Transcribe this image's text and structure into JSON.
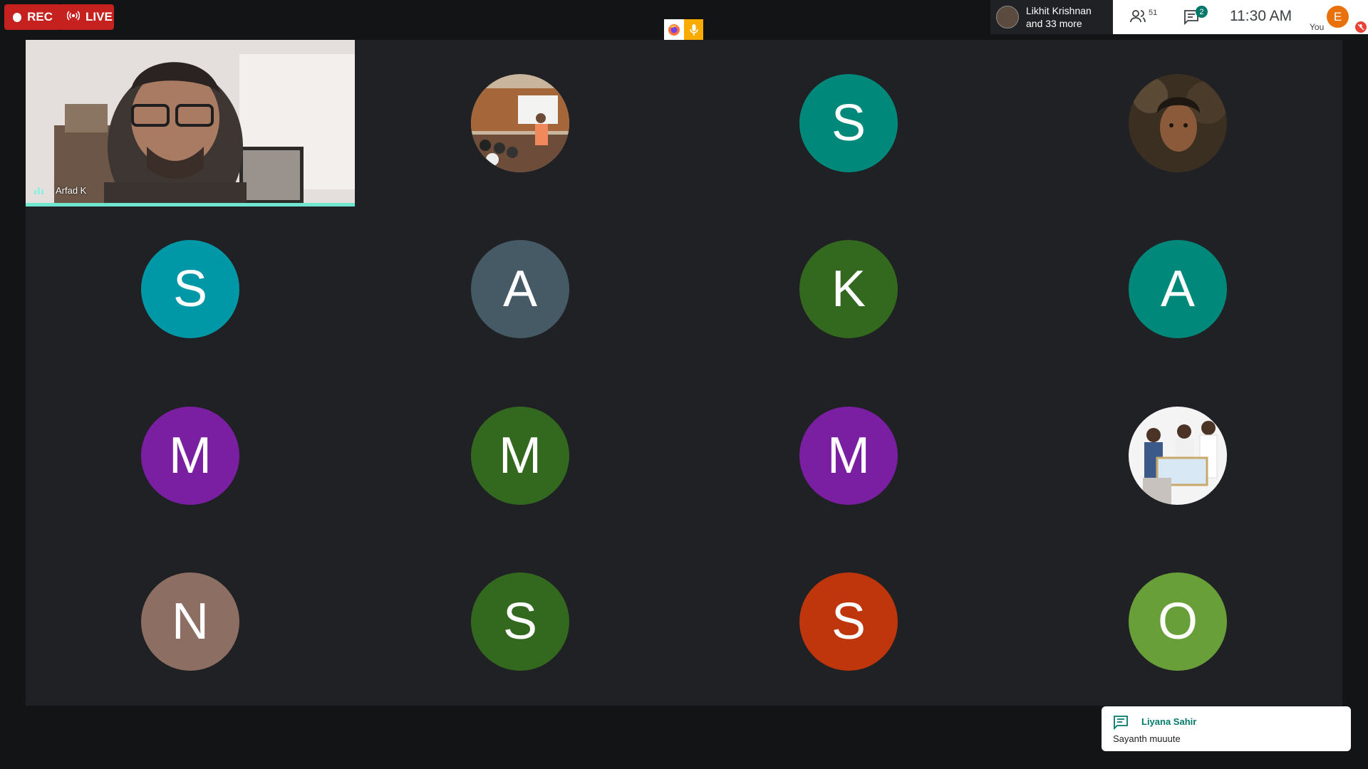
{
  "recording": {
    "rec_label": "REC",
    "live_label": "LIVE"
  },
  "presenter": {
    "name": "Likhit Krishnan",
    "more": "and 33 more"
  },
  "topbar": {
    "participants_count": "51",
    "chat_badge": "2",
    "clock": "11:30  AM",
    "you_initial": "E",
    "you_label": "You"
  },
  "active_speaker": {
    "name": "Arfad K"
  },
  "tiles": [
    {
      "initial": "S",
      "color": "#00897b"
    },
    {
      "initial": "S",
      "color": "#0097a7"
    },
    {
      "initial": "A",
      "color": "#455a64"
    },
    {
      "initial": "K",
      "color": "#33691e"
    },
    {
      "initial": "A",
      "color": "#00897b"
    },
    {
      "initial": "M",
      "color": "#7b1fa2"
    },
    {
      "initial": "M",
      "color": "#33691e"
    },
    {
      "initial": "M",
      "color": "#7b1fa2"
    },
    {
      "initial": "N",
      "color": "#8d6e63"
    },
    {
      "initial": "S",
      "color": "#33691e"
    },
    {
      "initial": "S",
      "color": "#bf360c"
    },
    {
      "initial": "O",
      "color": "#689f38"
    }
  ],
  "chat_toast": {
    "sender": "Liyana Sahir",
    "message": "Sayanth muuute"
  }
}
